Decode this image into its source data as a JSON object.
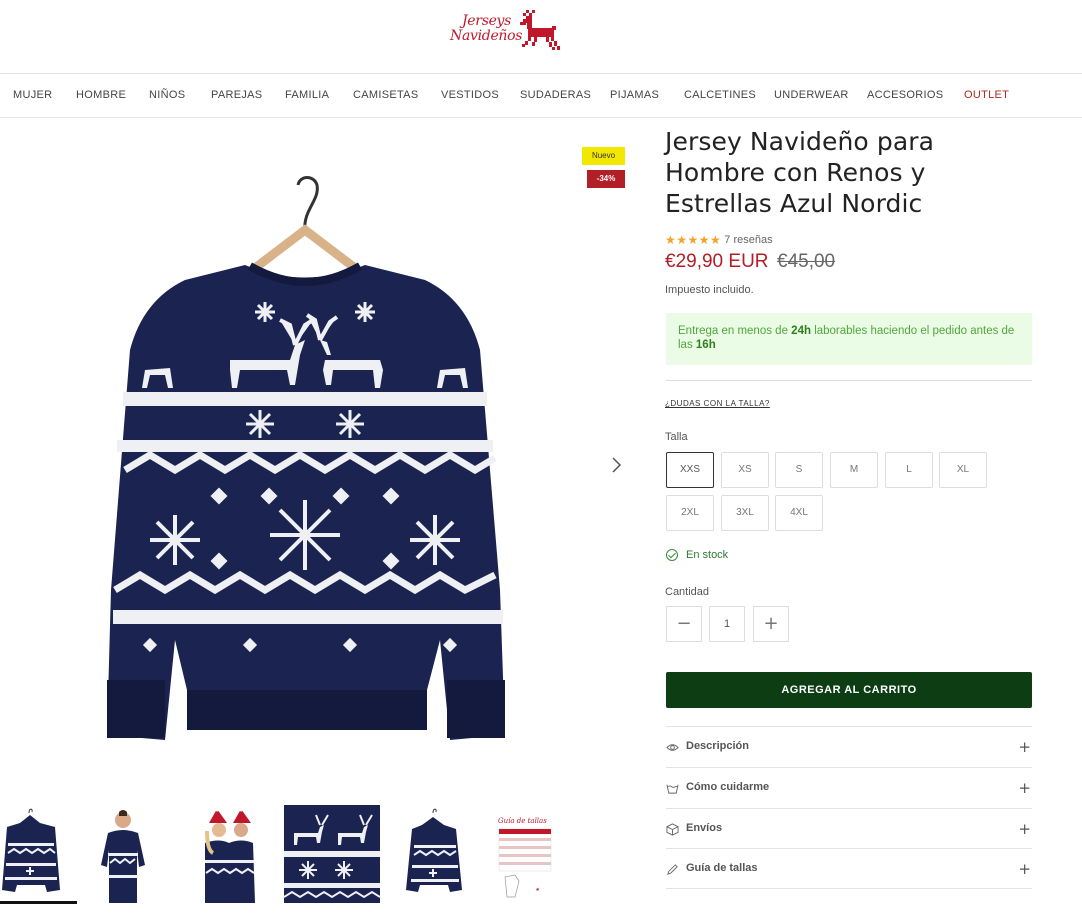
{
  "header": {
    "logo_line1": "Jerseys",
    "logo_line2": "Navideños"
  },
  "nav": {
    "items": [
      "MUJER",
      "HOMBRE",
      "NIÑOS",
      "PAREJAS",
      "FAMILIA",
      "CAMISETAS",
      "VESTIDOS",
      "SUDADERAS",
      "PIJAMAS",
      "CALCETINES",
      "UNDERWEAR",
      "ACCESORIOS",
      "OUTLET"
    ]
  },
  "gallery": {
    "badge_new": "Nuevo",
    "badge_discount": "-34%",
    "next_icon": "chevron-right-icon",
    "thumbnails": [
      "sweater-front",
      "man-wearing",
      "couple-wearing",
      "pattern-closeup",
      "sweater-back",
      "size-guide"
    ],
    "size_guide_thumb_title": "Guía de tallas"
  },
  "product": {
    "title": "Jersey Navideño para Hombre con Renos y Estrellas Azul Nordic",
    "rating_stars": "★★★★★",
    "reviews": "7 reseñas",
    "price": "€29,90 EUR",
    "price_old": "€45,00",
    "tax_note": "Impuesto incluido.",
    "delivery": {
      "pre": "Entrega en menos de ",
      "hours": "24h",
      "mid": " laborables haciendo el pedido antes de las ",
      "time": "16h"
    },
    "size_help": "¿DUDAS CON LA TALLA?",
    "size_label": "Talla",
    "sizes": [
      "XXS",
      "XS",
      "S",
      "M",
      "L",
      "XL",
      "2XL",
      "3XL",
      "4XL"
    ],
    "selected_size": "XXS",
    "stock": "En stock",
    "quantity_label": "Cantidad",
    "quantity": "1",
    "minus": "−",
    "plus": "+",
    "add_to_cart": "AGREGAR AL CARRITO",
    "accordions": [
      {
        "label": "Descripción",
        "icon": "eye-icon"
      },
      {
        "label": "Cómo cuidarme",
        "icon": "washing-icon"
      },
      {
        "label": "Envíos",
        "icon": "box-icon"
      },
      {
        "label": "Guía de tallas",
        "icon": "pencil-icon"
      }
    ],
    "accordion_toggle": "+"
  },
  "colors": {
    "brand_red": "#c0182a",
    "price_red": "#b11e26",
    "cart_green": "#0d3d13",
    "sweater_navy": "#1b2350"
  }
}
